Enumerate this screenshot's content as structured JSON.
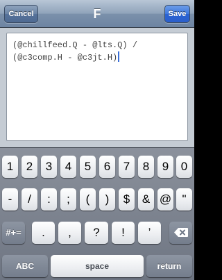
{
  "nav": {
    "cancel_label": "Cancel",
    "title": "F",
    "save_label": "Save"
  },
  "editor": {
    "line1": "(@chillfeed.Q - @lts.Q) /",
    "line2": "(@c3comp.H - @c3jt.H)"
  },
  "keyboard": {
    "row1": [
      "1",
      "2",
      "3",
      "4",
      "5",
      "6",
      "7",
      "8",
      "9",
      "0"
    ],
    "row2": [
      "-",
      "/",
      ":",
      ";",
      "(",
      ")",
      "$",
      "&",
      "@",
      "\""
    ],
    "row3_left": "#+=",
    "row3": [
      ".",
      ",",
      "?",
      "!",
      "’"
    ],
    "row3_right_icon": "backspace-icon",
    "row4": {
      "abc_label": "ABC",
      "space_label": "space",
      "return_label": "return"
    }
  },
  "colors": {
    "nav_bar": "#7b91ab",
    "save_button": "#2a63d3",
    "caret": "#3a6fd8",
    "keyboard_bg": "#7d8491"
  }
}
